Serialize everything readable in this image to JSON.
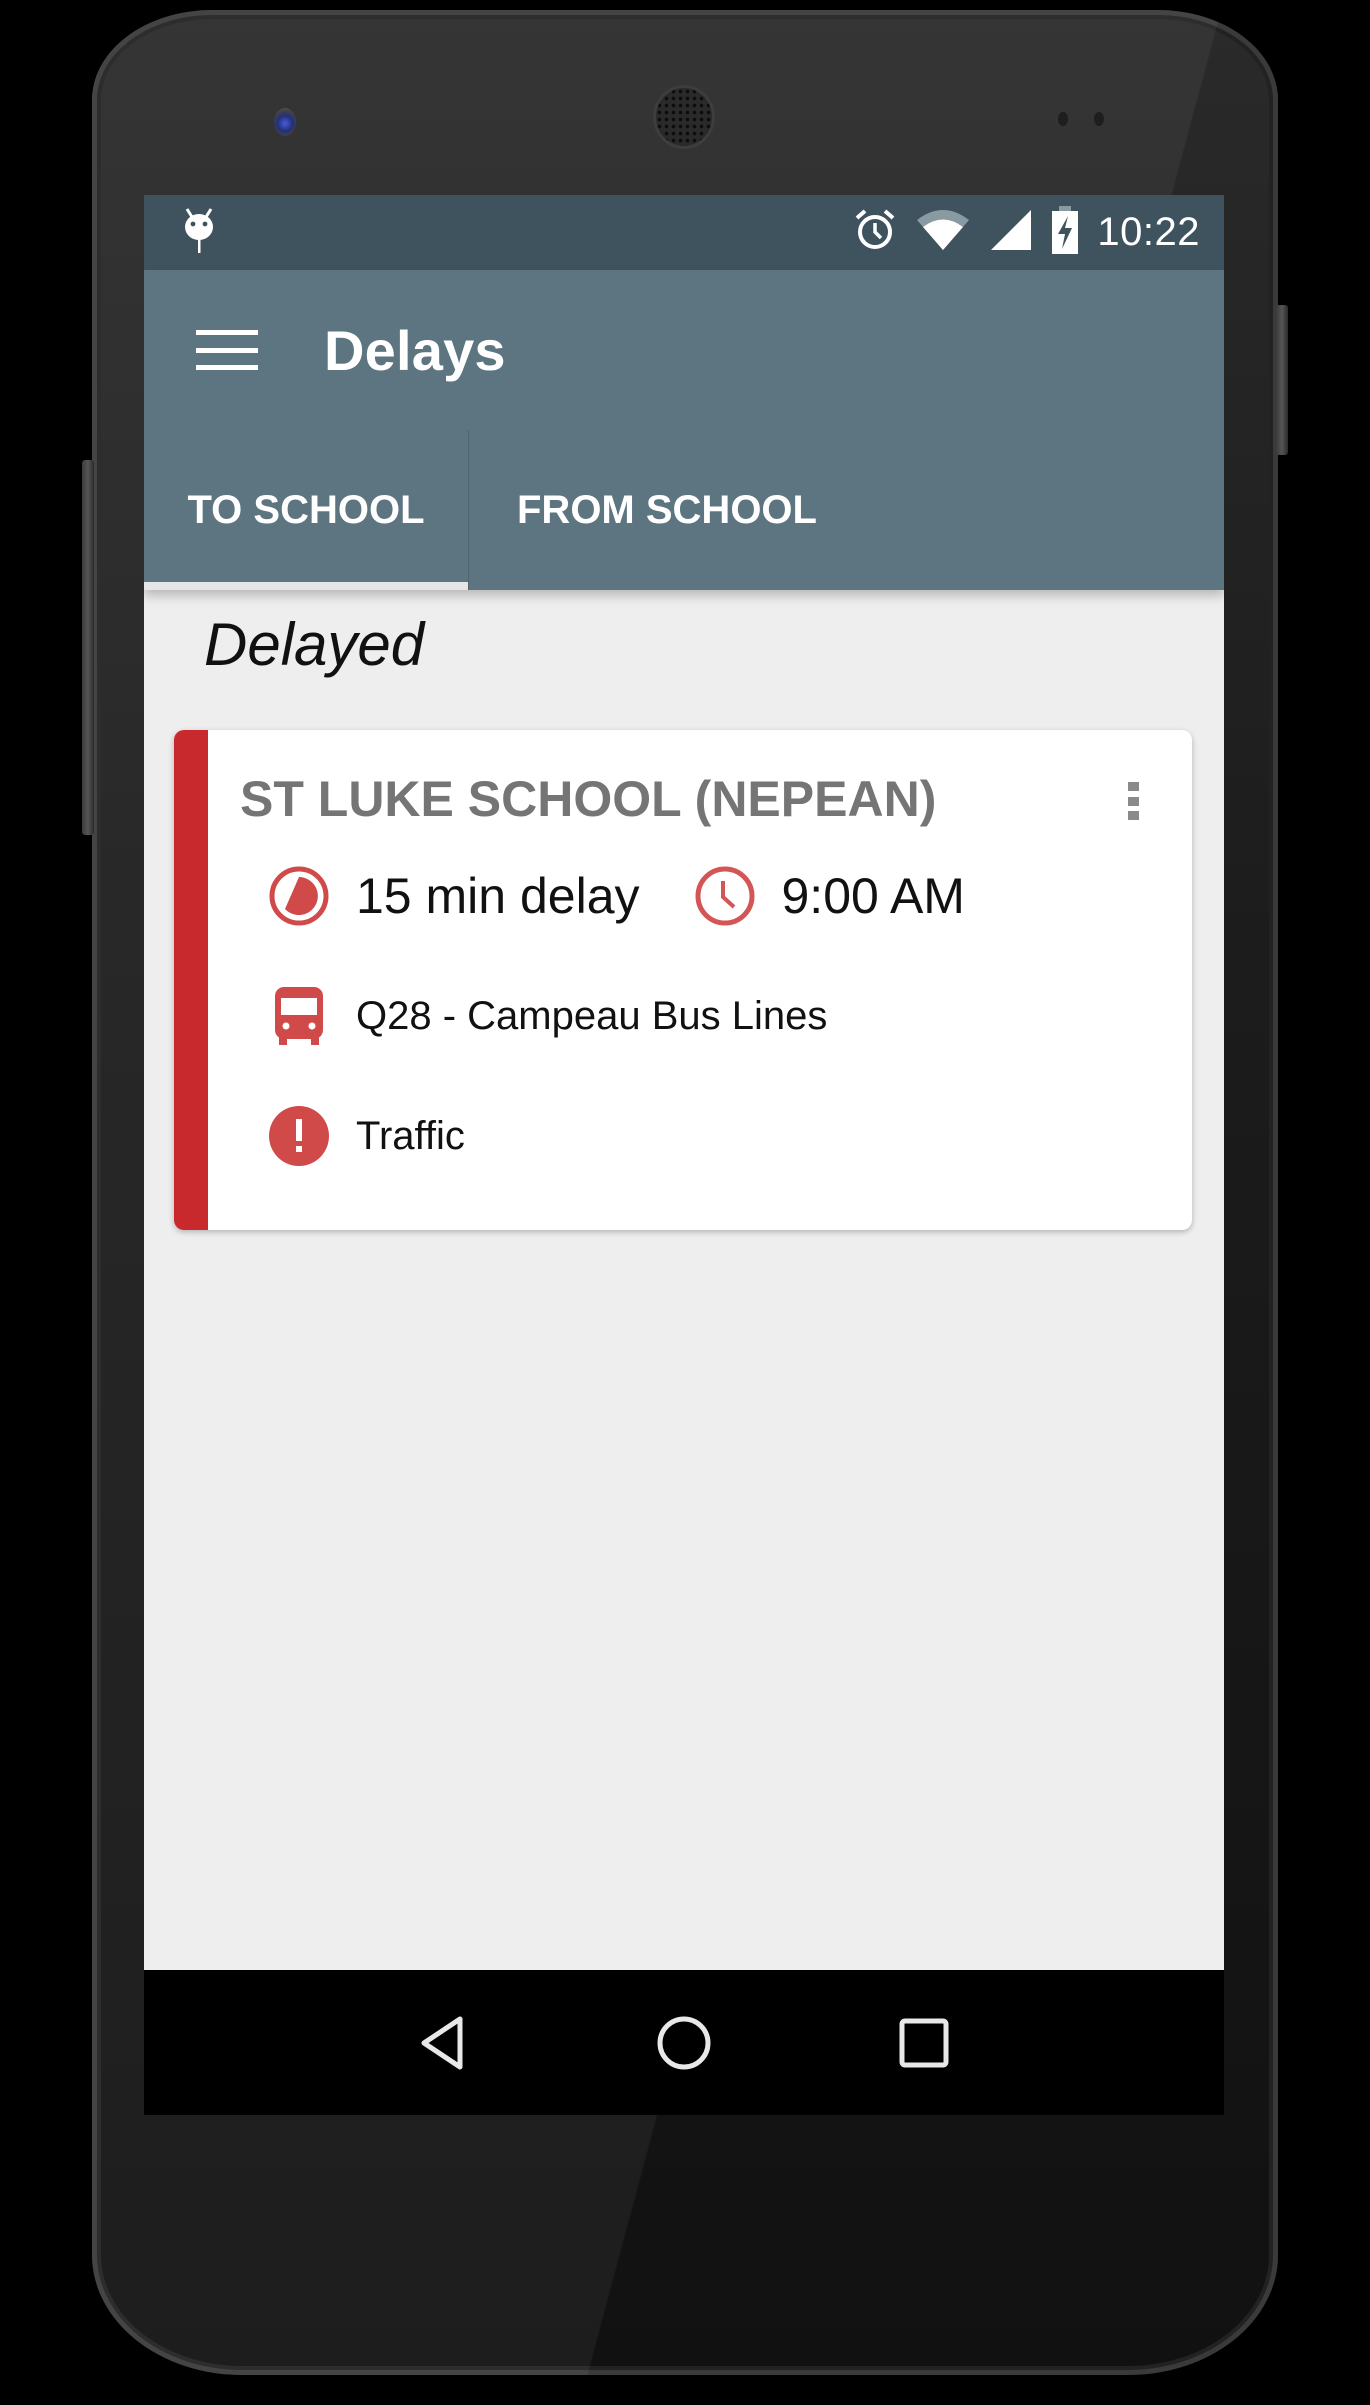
{
  "status_bar": {
    "time": "10:22",
    "icons": [
      "android-debug-icon",
      "alarm-icon",
      "wifi-icon",
      "cell-signal-icon",
      "battery-charging-icon"
    ]
  },
  "app_bar": {
    "title": "Delays",
    "menu_icon": "hamburger-menu-icon"
  },
  "tabs": [
    {
      "label": "TO SCHOOL",
      "selected": true
    },
    {
      "label": "FROM SCHOOL",
      "selected": false
    }
  ],
  "section": {
    "title": "Delayed"
  },
  "cards": [
    {
      "school": "ST LUKE SCHOOL (NEPEAN)",
      "status_color": "#c8292d",
      "delay": "15 min delay",
      "time": "9:00 AM",
      "bus": "Q28 - Campeau Bus Lines",
      "reason": "Traffic"
    }
  ],
  "nav_bar": {
    "buttons": [
      "back",
      "home",
      "recents"
    ]
  },
  "colors": {
    "primary": "#5d7481",
    "status_bar": "#3f535e",
    "accent_red": "#c8292d",
    "icon_red": "#d04a4a",
    "background": "#eeeeee"
  }
}
